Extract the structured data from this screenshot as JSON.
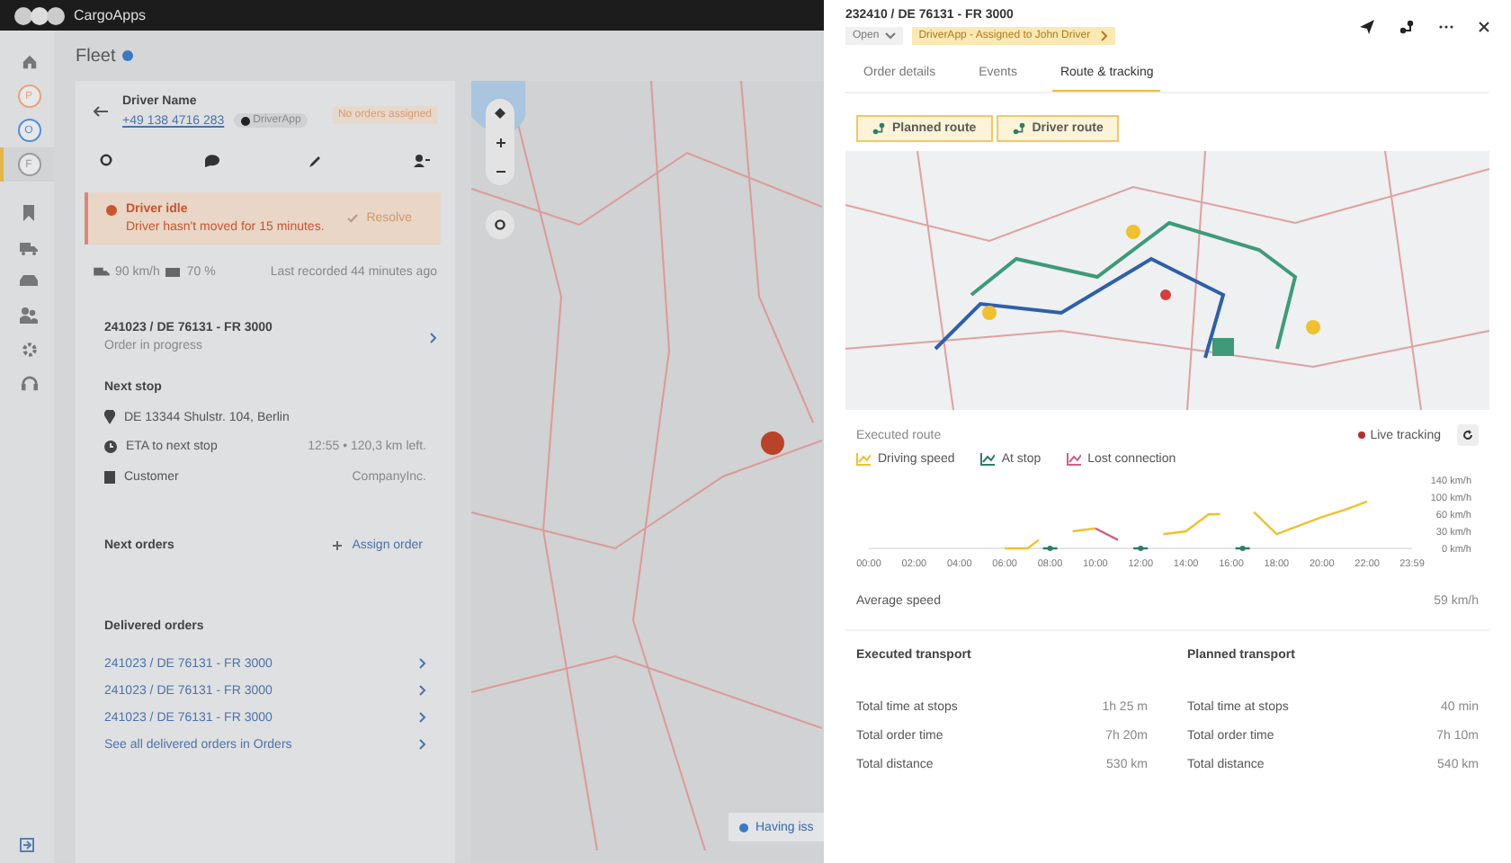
{
  "top_bar": {
    "app_name": "CargoApps"
  },
  "sidebar": {
    "nav_top": [
      {
        "selected": false
      }
    ],
    "avatars": [
      {
        "letter": "P",
        "color": "#e8a27c",
        "selected": false
      },
      {
        "letter": "O",
        "color": "#4f8fd6",
        "selected": false
      },
      {
        "letter": "F",
        "color": "#9a9a9a",
        "selected": true
      }
    ],
    "nav": [
      {
        "selected": false
      },
      {
        "selected": false
      },
      {
        "selected": false
      },
      {
        "selected": false
      },
      {
        "selected": false
      },
      {
        "selected": false
      }
    ]
  },
  "page": {
    "title": "Fleet"
  },
  "driver": {
    "name": "Driver Name",
    "phone": "+49 138 4716 283",
    "app": "DriverApp",
    "status": "No orders assigned"
  },
  "alert": {
    "title": "Driver idle",
    "message": "Driver hasn't moved for 15 minutes.",
    "action": "Resolve"
  },
  "stats": {
    "speed": "90 km/h",
    "battery": "70 %",
    "last_recorded": "Last recorded 44 minutes ago"
  },
  "current_order": {
    "id": "241023 / DE 76131 - FR 3000",
    "status": "Order in progress"
  },
  "next_stop": {
    "heading": "Next stop",
    "address": "DE 13344 Shulstr. 104, Berlin",
    "rows": [
      {
        "kind": "eta",
        "label": "ETA to next stop",
        "value": "12:55 • 120,3 km left."
      },
      {
        "kind": "customer",
        "label": "Customer",
        "value": "CompanyInc."
      }
    ]
  },
  "next_orders": {
    "heading": "Next orders",
    "action": "Assign order"
  },
  "delivered_orders": {
    "heading": "Delivered orders",
    "items": [
      "241023 / DE 76131 - FR 3000",
      "241023 / DE 76131 - FR 3000",
      "241023 / DE 76131 - FR 3000"
    ],
    "see_all": "See all delivered orders in Orders"
  },
  "map_toast": {
    "text": "Having iss"
  },
  "drawer": {
    "title": "232410 / DE 76131 - FR 3000",
    "status": "Open",
    "assignment": "DriverApp - Assigned to John Driver",
    "tabs": [
      {
        "label": "Order details",
        "selected": false
      },
      {
        "label": "Events",
        "selected": false
      },
      {
        "label": "Route & tracking",
        "selected": true
      }
    ],
    "route_toggles": [
      {
        "label": "Planned route",
        "selected": true
      },
      {
        "label": "Driver route",
        "selected": true
      }
    ],
    "executed_route": {
      "label": "Executed route",
      "live_tracking": "Live tracking",
      "chart_data": {
        "type": "line",
        "x": [
          6,
          7,
          7.5,
          8,
          9,
          10,
          11,
          12,
          13,
          14,
          15,
          15.5,
          16.5,
          17,
          18,
          19,
          20,
          21,
          22
        ],
        "xlim": [
          0,
          23.98
        ],
        "ylim": [
          0,
          140
        ],
        "xticks": [
          {
            "value": 0,
            "label": "00:00"
          },
          {
            "value": 2,
            "label": "02:00"
          },
          {
            "value": 4,
            "label": "04:00"
          },
          {
            "value": 6,
            "label": "06:00"
          },
          {
            "value": 8,
            "label": "08:00"
          },
          {
            "value": 10,
            "label": "10:00"
          },
          {
            "value": 12,
            "label": "12:00"
          },
          {
            "value": 14,
            "label": "14:00"
          },
          {
            "value": 16,
            "label": "16:00"
          },
          {
            "value": 18,
            "label": "18:00"
          },
          {
            "value": 20,
            "label": "20:00"
          },
          {
            "value": 22,
            "label": "22:00"
          },
          {
            "value": 23.98,
            "label": "23:59"
          }
        ],
        "yticks": [
          {
            "value": 0,
            "label": "0 km/h"
          },
          {
            "value": 30,
            "label": "30 km/h"
          },
          {
            "value": 60,
            "label": "60 km/h"
          },
          {
            "value": 100,
            "label": "100 km/h"
          },
          {
            "value": 140,
            "label": "140 km/h"
          }
        ],
        "series": [
          {
            "name": "Driving speed",
            "color": "#f0c030",
            "values": [
              0,
              0,
              15,
              null,
              30,
              35,
              null,
              null,
              25,
              30,
              60,
              60,
              null,
              65,
              25,
              40,
              55,
              70,
              90
            ]
          },
          {
            "name": "At stop",
            "color": "#2e7d6b",
            "marker": true,
            "values": [
              null,
              null,
              null,
              0,
              null,
              null,
              null,
              0,
              null,
              null,
              null,
              null,
              0,
              null,
              null,
              null,
              null,
              null,
              null
            ]
          },
          {
            "name": "Lost connection",
            "color": "#d06080",
            "values": [
              null,
              null,
              null,
              null,
              null,
              35,
              15,
              null,
              null,
              null,
              null,
              null,
              null,
              null,
              null,
              null,
              null,
              null,
              null
            ]
          }
        ]
      }
    },
    "average_speed": {
      "label": "Average speed",
      "value": "59 km/h"
    },
    "transport": [
      {
        "heading": "Executed transport",
        "rows": [
          {
            "label": "Total time at stops",
            "value": "1h 25 m"
          },
          {
            "label": "Total order time",
            "value": "7h 20m"
          },
          {
            "label": "Total distance",
            "value": "530 km"
          }
        ]
      },
      {
        "heading": "Planned transport",
        "rows": [
          {
            "label": "Total time at stops",
            "value": "40 min"
          },
          {
            "label": "Total order time",
            "value": "7h 10m"
          },
          {
            "label": "Total distance",
            "value": "540 km"
          }
        ]
      }
    ]
  }
}
